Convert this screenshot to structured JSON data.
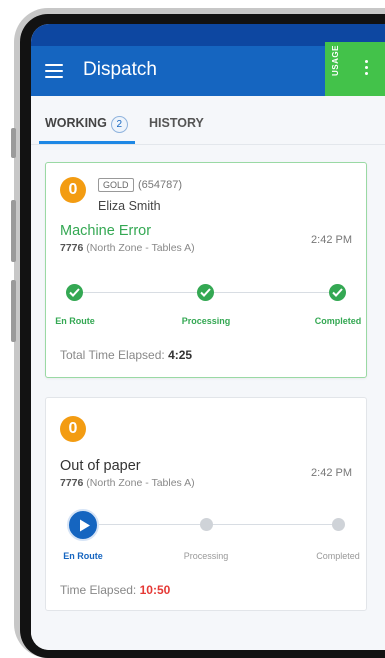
{
  "app": {
    "title": "Dispatch",
    "usage_label": "USAGE"
  },
  "tabs": [
    {
      "label": "WORKING",
      "count": "2",
      "active": true
    },
    {
      "label": "HISTORY",
      "active": false
    }
  ],
  "colors": {
    "primary": "#1565c0",
    "success": "#34a853",
    "warning": "#f39c12",
    "danger": "#e53935"
  },
  "tickets": [
    {
      "badge": "0",
      "tier": "GOLD",
      "account": "(654787)",
      "customer": "Eliza Smith",
      "issue": "Machine Error",
      "location_id": "7776",
      "location_desc": "(North Zone - Tables A)",
      "time": "2:42 PM",
      "steps": [
        {
          "label": "En Route",
          "state": "done"
        },
        {
          "label": "Processing",
          "state": "done"
        },
        {
          "label": "Completed",
          "state": "done"
        }
      ],
      "elapsed_label": "Total Time Elapsed:",
      "elapsed_value": "4:25"
    },
    {
      "badge": "0",
      "issue": "Out of paper",
      "location_id": "7776",
      "location_desc": "(North Zone - Tables A)",
      "time": "2:42 PM",
      "steps": [
        {
          "label": "En Route",
          "state": "active"
        },
        {
          "label": "Processing",
          "state": "pending"
        },
        {
          "label": "Completed",
          "state": "pending"
        }
      ],
      "elapsed_label": "Time Elapsed:",
      "elapsed_value": "10:50"
    }
  ]
}
